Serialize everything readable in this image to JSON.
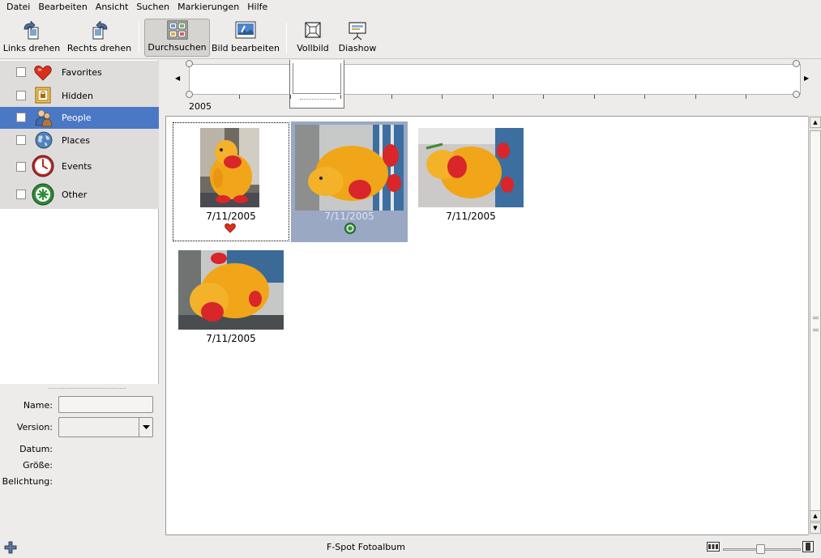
{
  "menubar": {
    "items": [
      {
        "label": "Datei"
      },
      {
        "label": "Bearbeiten"
      },
      {
        "label": "Ansicht"
      },
      {
        "label": "Suchen"
      },
      {
        "label": "Markierungen"
      },
      {
        "label": "Hilfe"
      }
    ]
  },
  "toolbar": {
    "rotate_left": "Links drehen",
    "rotate_right": "Rechts drehen",
    "browse": "Durchsuchen",
    "edit_image": "Bild bearbeiten",
    "fullscreen": "Vollbild",
    "slideshow": "Diashow"
  },
  "tags": [
    {
      "label": "Favorites",
      "icon": "heart-icon",
      "color": "#d9301c",
      "checked": false,
      "selected": false
    },
    {
      "label": "Hidden",
      "icon": "hidden-icon",
      "color": "#d59a22",
      "checked": false,
      "selected": false
    },
    {
      "label": "People",
      "icon": "people-icon",
      "color": "#b1753e",
      "checked": false,
      "selected": true
    },
    {
      "label": "Places",
      "icon": "globe-icon",
      "color": "#3a6ea5",
      "checked": false,
      "selected": false
    },
    {
      "label": "Events",
      "icon": "clock-icon",
      "color": "#b52b27",
      "checked": false,
      "selected": false
    },
    {
      "label": "Other",
      "icon": "other-icon",
      "color": "#2f8a35",
      "checked": false,
      "selected": false
    }
  ],
  "info": {
    "name_label": "Name:",
    "name_value": "",
    "version_label": "Version:",
    "version_value": "",
    "date_label": "Datum:",
    "size_label": "Größe:",
    "exposure_label": "Belichtung:"
  },
  "timeline": {
    "year": "2005"
  },
  "photos": [
    {
      "date": "7/11/2005",
      "badge": "heart-icon",
      "selected": false,
      "focused": true
    },
    {
      "date": "7/11/2005",
      "badge": "other-icon",
      "selected": true,
      "focused": false
    },
    {
      "date": "7/11/2005",
      "badge": null,
      "selected": false,
      "focused": false
    },
    {
      "date": "7/11/2005",
      "badge": null,
      "selected": false,
      "focused": false
    }
  ],
  "status": {
    "text": "F-Spot Fotoalbum"
  },
  "colors": {
    "selection": "#4b78c5",
    "photo_selection": "#9aa8c4",
    "window_bg": "#edeceb"
  }
}
